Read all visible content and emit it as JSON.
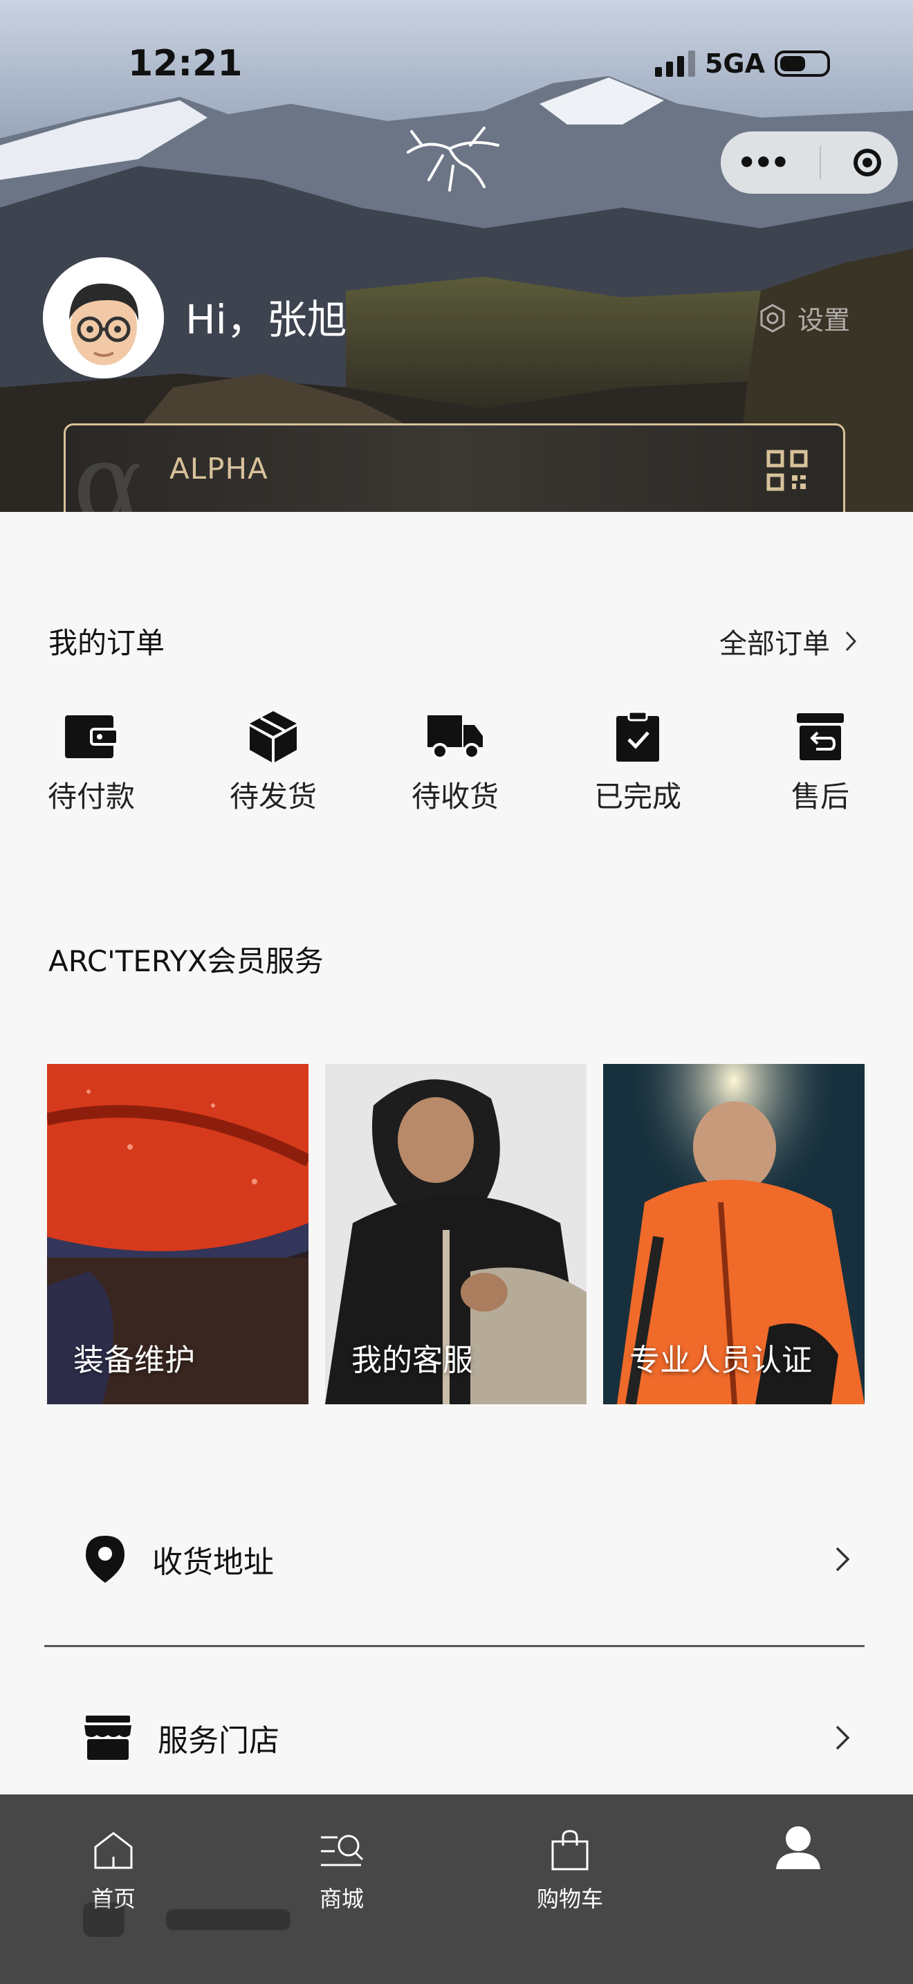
{
  "status_bar": {
    "time": "12:21",
    "network": "5GA"
  },
  "header": {
    "greeting": "Hi，张旭",
    "settings_label": "设置",
    "membership_card": {
      "tier": "ALPHA"
    }
  },
  "orders": {
    "title": "我的订单",
    "all_link": "全部订单",
    "items": [
      {
        "label": "待付款",
        "icon": "wallet-icon"
      },
      {
        "label": "待发货",
        "icon": "package-icon"
      },
      {
        "label": "待收货",
        "icon": "truck-icon"
      },
      {
        "label": "已完成",
        "icon": "clipboard-check-icon"
      },
      {
        "label": "售后",
        "icon": "return-box-icon"
      }
    ]
  },
  "services": {
    "title": "ARC'TERYX会员服务",
    "cards": [
      {
        "label": "装备维护"
      },
      {
        "label": "我的客服"
      },
      {
        "label": "专业人员认证"
      }
    ]
  },
  "menu": [
    {
      "label": "收货地址",
      "icon": "location-pin-icon"
    },
    {
      "label": "服务门店",
      "icon": "store-icon"
    }
  ],
  "tabbar": [
    {
      "label": "首页",
      "icon": "home-icon"
    },
    {
      "label": "商城",
      "icon": "shop-search-icon"
    },
    {
      "label": "购物车",
      "icon": "shopping-bag-icon"
    },
    {
      "label": "",
      "icon": "profile-icon",
      "active": true
    }
  ],
  "colors": {
    "accent_gold": "#d8c29a",
    "tabbar_bg": "#474747",
    "page_bg": "#f7f7f7"
  }
}
